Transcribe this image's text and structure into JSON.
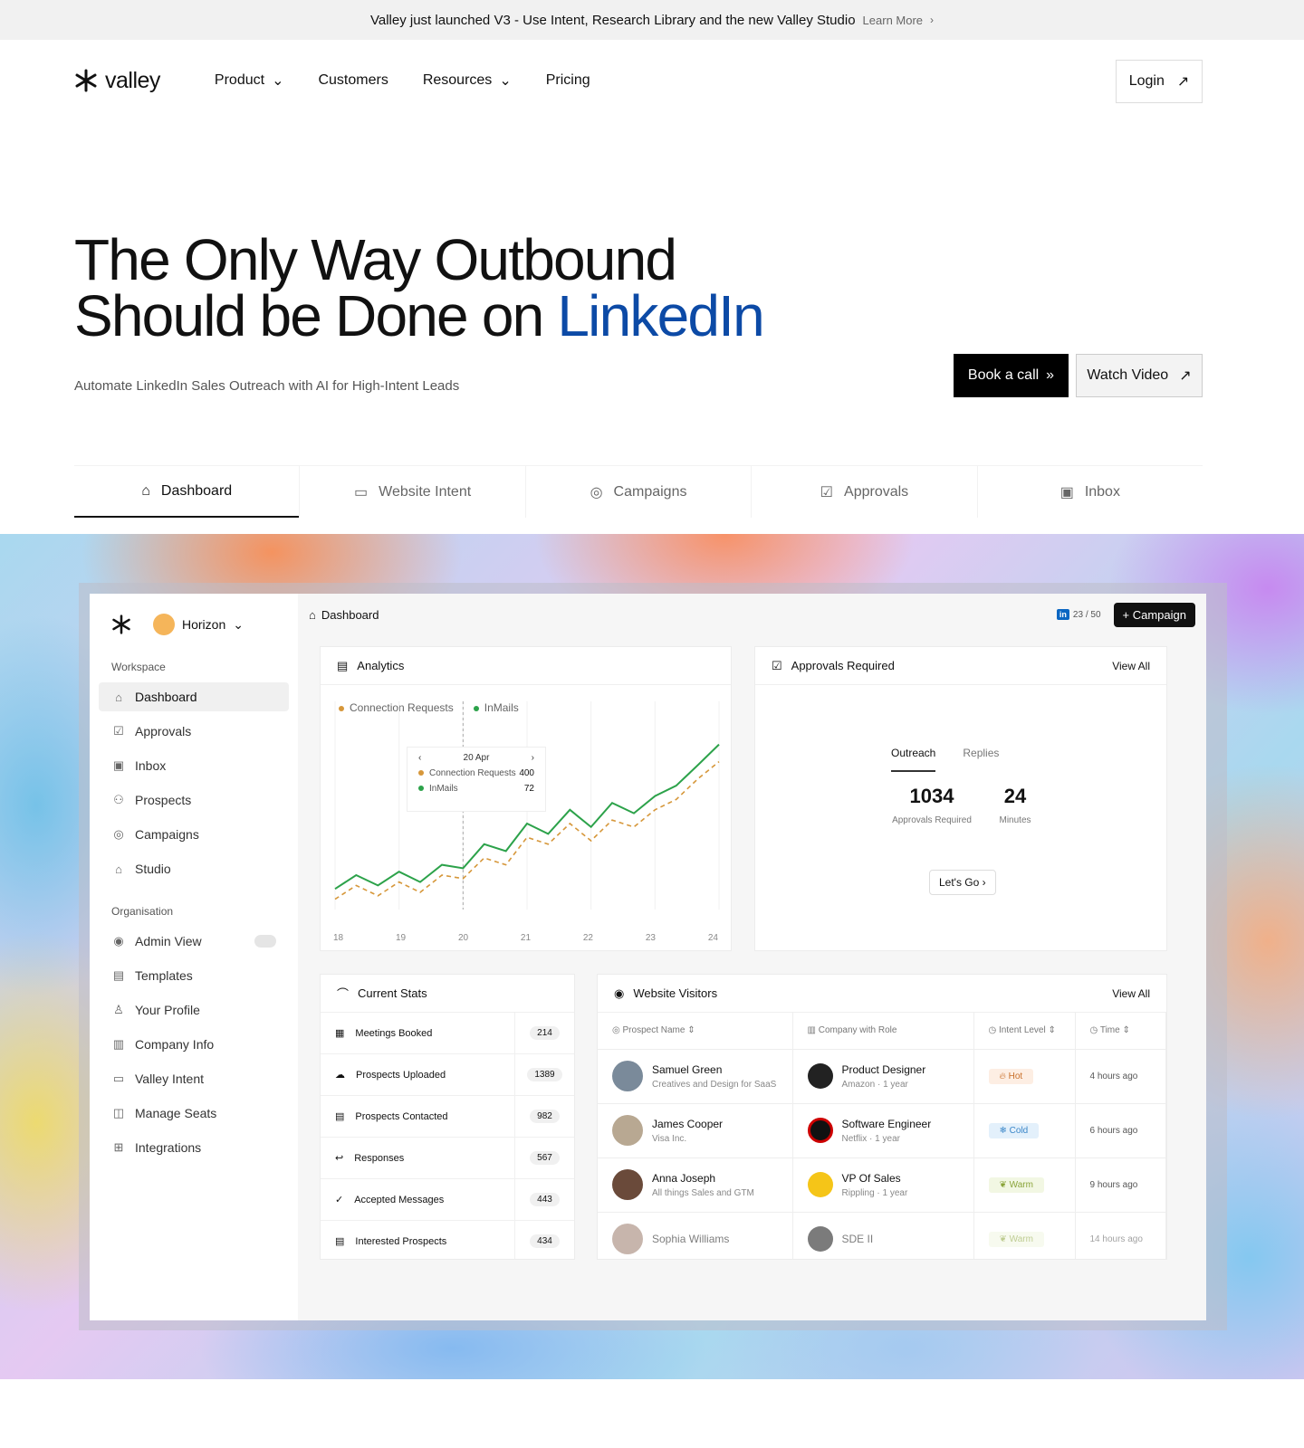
{
  "banner": {
    "text": "Valley just launched V3 - Use Intent, Research Library and the new Valley Studio",
    "link": "Learn More"
  },
  "nav": {
    "logo": "valley",
    "items": [
      "Product",
      "Customers",
      "Resources",
      "Pricing"
    ],
    "login": "Login"
  },
  "hero": {
    "title_line1": "The Only Way Outbound",
    "title_line2_prefix": "Should be Done on ",
    "title_line2_accent": "LinkedIn",
    "subtitle": "Automate LinkedIn Sales Outreach with AI for High-Intent Leads",
    "cta_primary": "Book a call",
    "cta_secondary": "Watch Video",
    "accent_color": "#0c4aa6"
  },
  "tabs": [
    "Dashboard",
    "Website Intent",
    "Campaigns",
    "Approvals",
    "Inbox"
  ],
  "app": {
    "org": "Horizon",
    "workspace_label": "Workspace",
    "workspace_items": [
      "Dashboard",
      "Approvals",
      "Inbox",
      "Prospects",
      "Campaigns",
      "Studio"
    ],
    "organisation_label": "Organisation",
    "org_items": [
      "Admin View",
      "Templates",
      "Your Profile",
      "Company Info",
      "Valley Intent",
      "Manage Seats",
      "Integrations"
    ],
    "breadcrumb": "Dashboard",
    "seats": "23 / 50",
    "campaign_btn": "Campaign",
    "analytics": {
      "title": "Analytics",
      "legend": [
        "Connection Requests",
        "InMails"
      ],
      "tooltip": {
        "date": "20 Apr",
        "rows": [
          {
            "label": "Connection Requests",
            "value": "400"
          },
          {
            "label": "InMails",
            "value": "72"
          }
        ]
      },
      "x_labels": [
        "18",
        "19",
        "20",
        "21",
        "22",
        "23",
        "24"
      ]
    },
    "approvals": {
      "title": "Approvals Required",
      "view_all": "View All",
      "tab1": "Outreach",
      "tab2": "Replies",
      "num1": "1034",
      "lbl1": "Approvals Required",
      "num2": "24",
      "lbl2": "Minutes",
      "cta": "Let's Go"
    },
    "stats": {
      "title": "Current Stats",
      "rows": [
        {
          "label": "Meetings Booked",
          "value": "214"
        },
        {
          "label": "Prospects Uploaded",
          "value": "1389"
        },
        {
          "label": "Prospects Contacted",
          "value": "982"
        },
        {
          "label": "Responses",
          "value": "567"
        },
        {
          "label": "Accepted Messages",
          "value": "443"
        },
        {
          "label": "Interested Prospects",
          "value": "434"
        }
      ]
    },
    "visitors": {
      "title": "Website Visitors",
      "view_all": "View All",
      "headers": [
        "Prospect Name",
        "Company with Role",
        "Intent Level",
        "Time"
      ],
      "rows": [
        {
          "name": "Samuel Green",
          "sub": "Creatives and Design for SaaS",
          "role": "Product Designer",
          "company": "Amazon · 1 year",
          "intent": "Hot",
          "time": "4 hours ago"
        },
        {
          "name": "James Cooper",
          "sub": "Visa Inc.",
          "role": "Software Engineer",
          "company": "Netflix · 1 year",
          "intent": "Cold",
          "time": "6 hours ago"
        },
        {
          "name": "Anna Joseph",
          "sub": "All things Sales and GTM",
          "role": "VP Of Sales",
          "company": "Rippling · 1 year",
          "intent": "Warm",
          "time": "9 hours ago"
        },
        {
          "name": "Sophia Williams",
          "sub": "",
          "role": "SDE II",
          "company": "",
          "intent": "Warm",
          "time": "14 hours ago"
        }
      ]
    }
  },
  "chart_data": {
    "type": "line",
    "x": [
      18,
      18.33,
      18.67,
      19,
      19.33,
      19.67,
      20,
      20.33,
      20.67,
      21,
      21.33,
      21.67,
      22,
      22.33,
      22.67,
      23,
      23.33,
      23.67,
      24
    ],
    "series": [
      {
        "name": "Connection Requests",
        "values": [
          12,
          20,
          14,
          22,
          16,
          26,
          24,
          38,
          34,
          50,
          44,
          58,
          48,
          62,
          56,
          66,
          72,
          84,
          96
        ]
      },
      {
        "name": "InMails",
        "values": [
          6,
          14,
          8,
          16,
          10,
          20,
          18,
          30,
          26,
          42,
          38,
          50,
          40,
          52,
          48,
          58,
          64,
          76,
          86
        ]
      }
    ],
    "colors": [
      "#2ca24a",
      "#d6973a"
    ]
  }
}
